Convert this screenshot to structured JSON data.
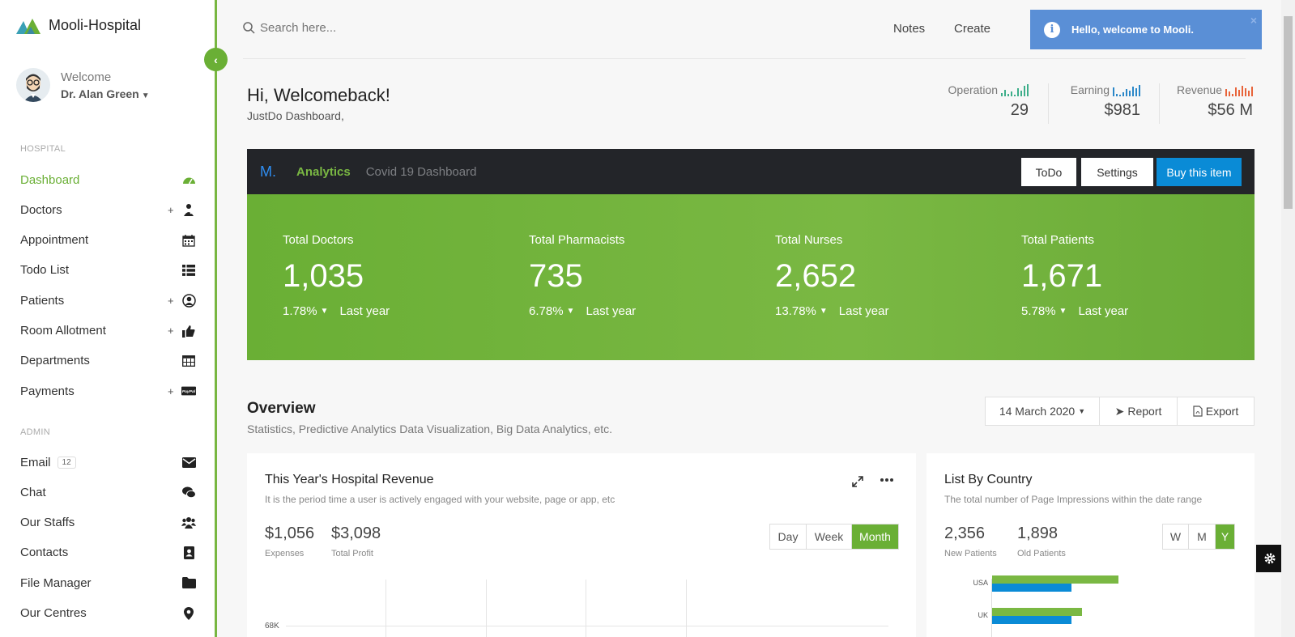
{
  "brand": {
    "name": "Mooli-Hospital",
    "colors": {
      "green": "#6aaf35",
      "teal": "#3aa0b5"
    }
  },
  "profile": {
    "welcome": "Welcome",
    "name": "Dr. Alan Green"
  },
  "sidebar": {
    "sections": [
      {
        "label": "HOSPITAL",
        "items": [
          {
            "label": "Dashboard",
            "icon": "dashboard-icon",
            "plus": "",
            "active": true
          },
          {
            "label": "Doctors",
            "icon": "doctor-icon",
            "plus": "+"
          },
          {
            "label": "Appointment",
            "icon": "calendar-icon",
            "plus": ""
          },
          {
            "label": "Todo List",
            "icon": "list-icon",
            "plus": ""
          },
          {
            "label": "Patients",
            "icon": "user-circle-icon",
            "plus": "+"
          },
          {
            "label": "Room Allotment",
            "icon": "thumbs-up-icon",
            "plus": "+"
          },
          {
            "label": "Departments",
            "icon": "table-icon",
            "plus": ""
          },
          {
            "label": "Payments",
            "icon": "paypal-icon",
            "plus": "+"
          }
        ]
      },
      {
        "label": "ADMIN",
        "items": [
          {
            "label": "Email",
            "badge": "12",
            "icon": "envelope-icon",
            "plus": ""
          },
          {
            "label": "Chat",
            "icon": "chat-icon",
            "plus": ""
          },
          {
            "label": "Our Staffs",
            "icon": "users-icon",
            "plus": ""
          },
          {
            "label": "Contacts",
            "icon": "address-book-icon",
            "plus": ""
          },
          {
            "label": "File Manager",
            "icon": "folder-icon",
            "plus": ""
          },
          {
            "label": "Our Centres",
            "icon": "map-marker-icon",
            "plus": ""
          }
        ]
      }
    ]
  },
  "topbar": {
    "search_placeholder": "Search here...",
    "notes": "Notes",
    "create": "Create"
  },
  "toast": {
    "message": "Hello, welcome to Mooli.",
    "color": "#5a8fd6"
  },
  "header": {
    "greeting": "Hi, Welcomeback!",
    "subtitle": "JustDo Dashboard,"
  },
  "kpis": [
    {
      "label": "Operation",
      "value": "29",
      "color": "#3dae8a"
    },
    {
      "label": "Earning",
      "value": "$981",
      "color": "#2a87c8"
    },
    {
      "label": "Revenue",
      "value": "$56 M",
      "color": "#e8643a"
    }
  ],
  "darkbar": {
    "logo": "M.",
    "active_tab": "Analytics",
    "tab": "Covid 19 Dashboard",
    "btn_todo": "ToDo",
    "btn_settings": "Settings",
    "btn_buy": "Buy this item"
  },
  "stats": [
    {
      "label": "Total Doctors",
      "value": "1,035",
      "change": "1.78%",
      "period": "Last year"
    },
    {
      "label": "Total Pharmacists",
      "value": "735",
      "change": "6.78%",
      "period": "Last year"
    },
    {
      "label": "Total Nurses",
      "value": "2,652",
      "change": "13.78%",
      "period": "Last year"
    },
    {
      "label": "Total Patients",
      "value": "1,671",
      "change": "5.78%",
      "period": "Last year"
    }
  ],
  "overview": {
    "title": "Overview",
    "subtitle": "Statistics, Predictive Analytics Data Visualization, Big Data Analytics, etc.",
    "date": "14 March 2020",
    "report": "Report",
    "export": "Export"
  },
  "revenue_card": {
    "title": "This Year's Hospital Revenue",
    "subtitle": "It is the period time a user is actively engaged with your website, page or app, etc",
    "expenses_value": "$1,056",
    "expenses_label": "Expenses",
    "profit_value": "$3,098",
    "profit_label": "Total Profit",
    "seg": [
      "Day",
      "Week",
      "Month"
    ],
    "seg_active": 2,
    "y_tick": "68K"
  },
  "country_card": {
    "title": "List By Country",
    "subtitle": "The total number of Page Impressions within the date range",
    "new_value": "2,356",
    "new_label": "New Patients",
    "old_value": "1,898",
    "old_label": "Old Patients",
    "seg": [
      "W",
      "M",
      "Y"
    ],
    "seg_active": 2,
    "bars": [
      {
        "label": "USA",
        "green": 0.8,
        "blue": 0.5
      },
      {
        "label": "UK",
        "green": 0.57,
        "blue": 0.5
      }
    ],
    "colors": {
      "green": "#7ab843",
      "blue": "#0a8bd6"
    }
  }
}
